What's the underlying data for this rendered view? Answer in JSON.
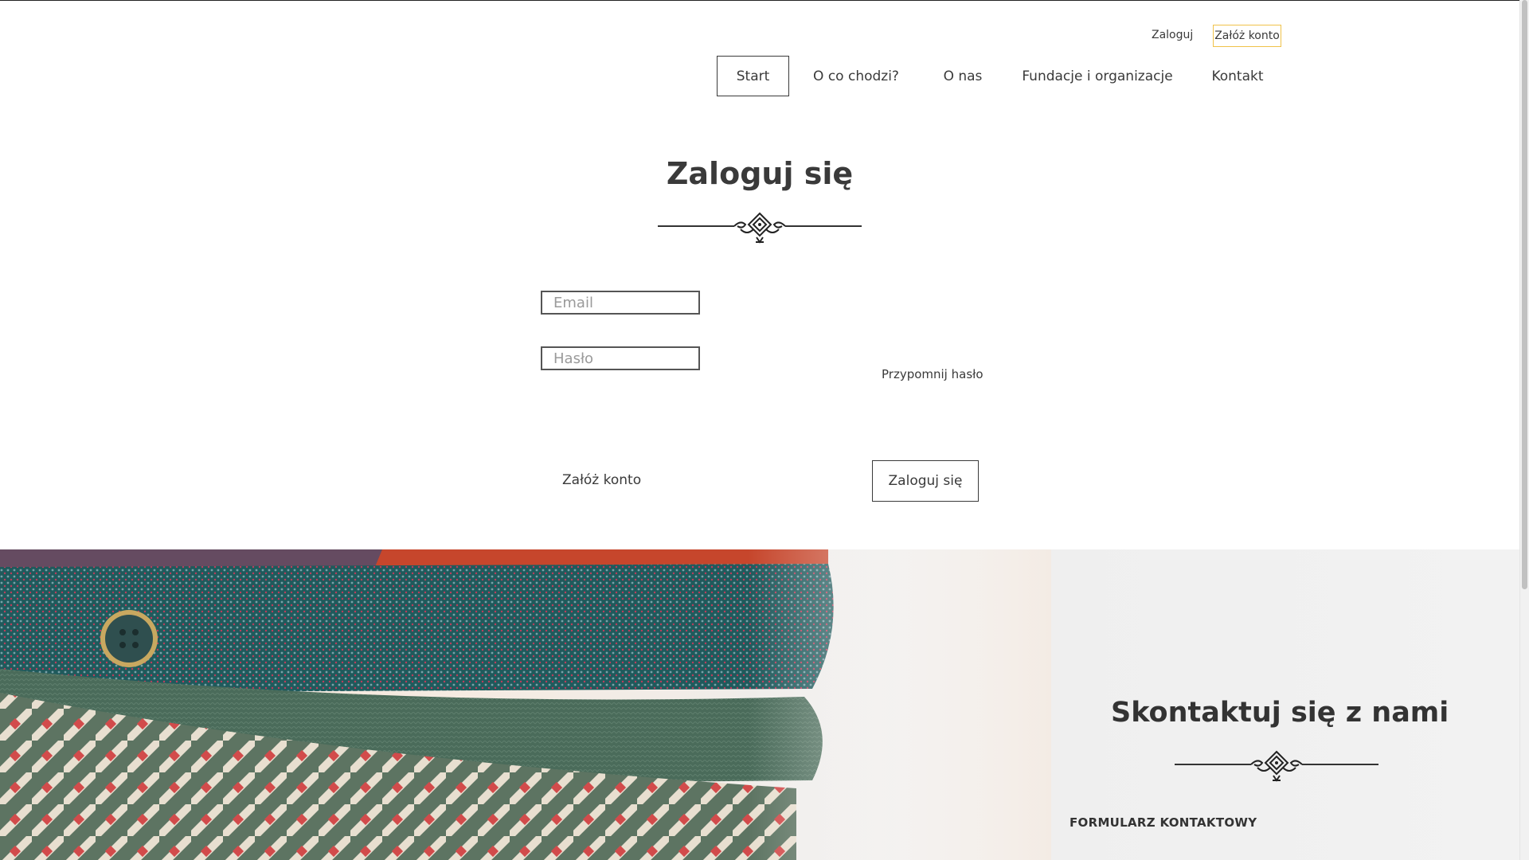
{
  "header": {
    "login_link": "Zaloguj",
    "register_link": "Załóż konto",
    "register_border_color": "#f0c24a"
  },
  "nav": {
    "items": [
      {
        "label": "Start",
        "active": true
      },
      {
        "label": "O co chodzi?",
        "active": false
      },
      {
        "label": "O nas",
        "active": false
      },
      {
        "label": "Fundacje i organizacje",
        "active": false
      },
      {
        "label": "Kontakt",
        "active": false
      }
    ]
  },
  "login": {
    "title": "Zaloguj się",
    "ornament_icon": "decorative-divider-icon",
    "email_placeholder": "Email",
    "email_value": "",
    "password_placeholder": "Hasło",
    "password_value": "",
    "remind_password": "Przypomnij hasło",
    "register_link": "Załóż konto",
    "submit_button": "Zaloguj się"
  },
  "contact": {
    "title": "Skontaktuj się z nami",
    "ornament_icon": "decorative-divider-icon",
    "form_label": "FORMULARZ KONTAKTOWY"
  }
}
